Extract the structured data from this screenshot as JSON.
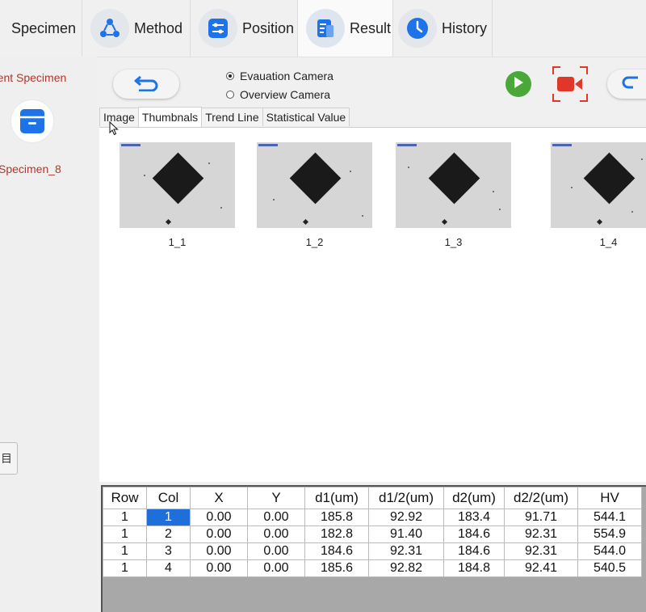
{
  "nav": {
    "tabs": [
      {
        "label": "Specimen",
        "icon": "specimen-icon"
      },
      {
        "label": "Method",
        "icon": "share-nodes-icon"
      },
      {
        "label": "Position",
        "icon": "sliders-icon"
      },
      {
        "label": "Result",
        "icon": "result-document-icon",
        "active": true
      },
      {
        "label": "History",
        "icon": "clock-icon"
      }
    ]
  },
  "left_panel": {
    "current_specimen_label": "rent Specimen",
    "specimen_name": "Specimen_8",
    "bottom_button_label": "目"
  },
  "toolbar": {
    "camera_options": [
      {
        "label": "Evauation Camera",
        "checked": true
      },
      {
        "label": "Overview Camera",
        "checked": false
      }
    ]
  },
  "subtabs": [
    {
      "label": "Image",
      "active": false
    },
    {
      "label": "Thumbnals",
      "active": true
    },
    {
      "label": "Trend Line",
      "active": false
    },
    {
      "label": "Statistical Value",
      "active": false
    }
  ],
  "thumbnails": [
    {
      "label": "1_1"
    },
    {
      "label": "1_2"
    },
    {
      "label": "1_3"
    },
    {
      "label": "1_4"
    }
  ],
  "results_table": {
    "headers": [
      "Row",
      "Col",
      "X",
      "Y",
      "d1(um)",
      "d1/2(um)",
      "d2(um)",
      "d2/2(um)",
      "HV"
    ],
    "rows": [
      [
        "1",
        "1",
        "0.00",
        "0.00",
        "185.8",
        "92.92",
        "183.4",
        "91.71",
        "544.1"
      ],
      [
        "1",
        "2",
        "0.00",
        "0.00",
        "182.8",
        "91.40",
        "184.6",
        "92.31",
        "554.9"
      ],
      [
        "1",
        "3",
        "0.00",
        "0.00",
        "184.6",
        "92.31",
        "184.6",
        "92.31",
        "544.0"
      ],
      [
        "1",
        "4",
        "0.00",
        "0.00",
        "185.6",
        "92.82",
        "184.8",
        "92.41",
        "540.5"
      ]
    ],
    "selected_cell": {
      "row": 0,
      "col": 1
    }
  },
  "colors": {
    "accent_red": "#b0372b",
    "play_green": "#49a838",
    "record_red": "#e0372a",
    "selection_blue": "#1e6fd9",
    "icon_blue": "#1e73e8"
  }
}
